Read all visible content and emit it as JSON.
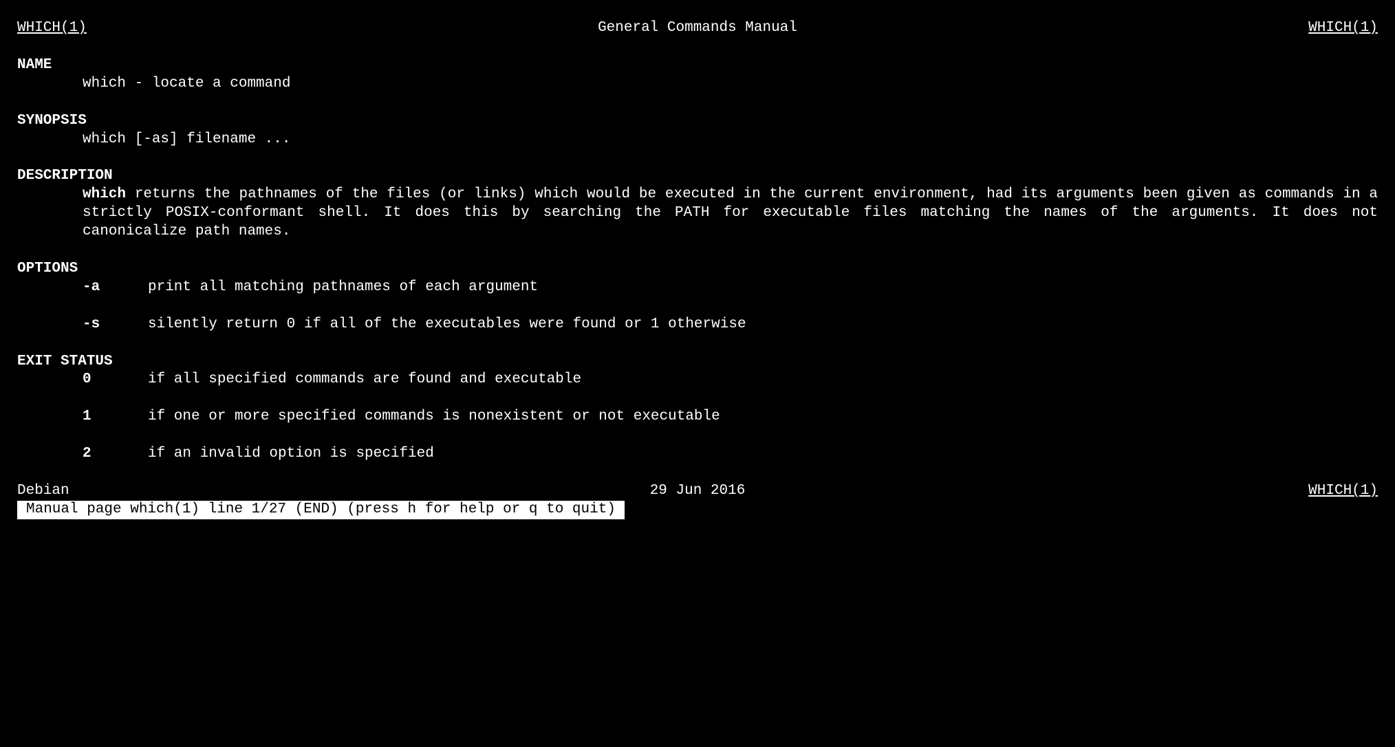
{
  "header": {
    "left": "WHICH(1)",
    "center": "General Commands Manual",
    "right": "WHICH(1)"
  },
  "sections": {
    "name": {
      "header": "NAME",
      "text": "which - locate a command"
    },
    "synopsis": {
      "header": "SYNOPSIS",
      "text": "which [-as] filename ..."
    },
    "description": {
      "header": "DESCRIPTION",
      "cmd": "which",
      "text": " returns the pathnames of the files (or links) which would be executed in the current environment, had its arguments been given as commands in a strictly POSIX-conformant shell.  It does this by search­ing  the  PATH for executable files matching the names of the arguments.  It does not canonicalize path names."
    },
    "options": {
      "header": "OPTIONS",
      "items": [
        {
          "flag": "-a",
          "desc": "print all matching pathnames of each argument"
        },
        {
          "flag": "-s",
          "desc": "silently return 0 if all of the executables were found or 1 otherwise"
        }
      ]
    },
    "exit_status": {
      "header": "EXIT STATUS",
      "items": [
        {
          "flag": "0",
          "desc": "if all specified commands are found and executable"
        },
        {
          "flag": "1",
          "desc": "if one or more specified commands is nonexistent or not executable"
        },
        {
          "flag": "2",
          "desc": "if an invalid option is specified"
        }
      ]
    }
  },
  "footer": {
    "left": "Debian",
    "center": "29 Jun 2016",
    "right": "WHICH(1)"
  },
  "status_bar": "Manual page which(1) line 1/27 (END) (press h for help or q to quit)"
}
